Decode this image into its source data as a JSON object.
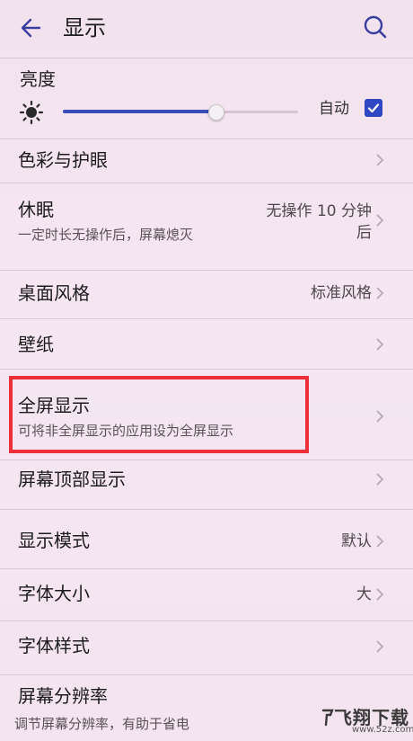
{
  "header": {
    "title": "显示"
  },
  "brightness": {
    "title": "亮度",
    "level": 0.65,
    "auto_label": "自动",
    "auto_checked": true
  },
  "rows": [
    {
      "title": "色彩与护眼"
    },
    {
      "title": "休眠",
      "subtitle": "一定时长无操作后，屏幕熄灭",
      "value_line1": "无操作 10 分钟",
      "value_line2": "后"
    },
    {
      "title": "桌面风格",
      "value": "标准风格"
    },
    {
      "title": "壁纸"
    },
    {
      "title": "全屏显示",
      "subtitle": "可将非全屏显示的应用设为全屏显示"
    },
    {
      "title": "屏幕顶部显示"
    },
    {
      "title": "显示模式",
      "value": "默认"
    },
    {
      "title": "字体大小",
      "value": "大"
    },
    {
      "title": "字体样式"
    },
    {
      "title": "屏幕分辨率",
      "subtitle": "调节屏幕分辨率，有助于省电"
    }
  ],
  "watermark": {
    "text": "飞翔下载",
    "url": "www.52z.com"
  },
  "colors": {
    "accent": "#3046c3",
    "highlight": "#ee2f3a"
  }
}
